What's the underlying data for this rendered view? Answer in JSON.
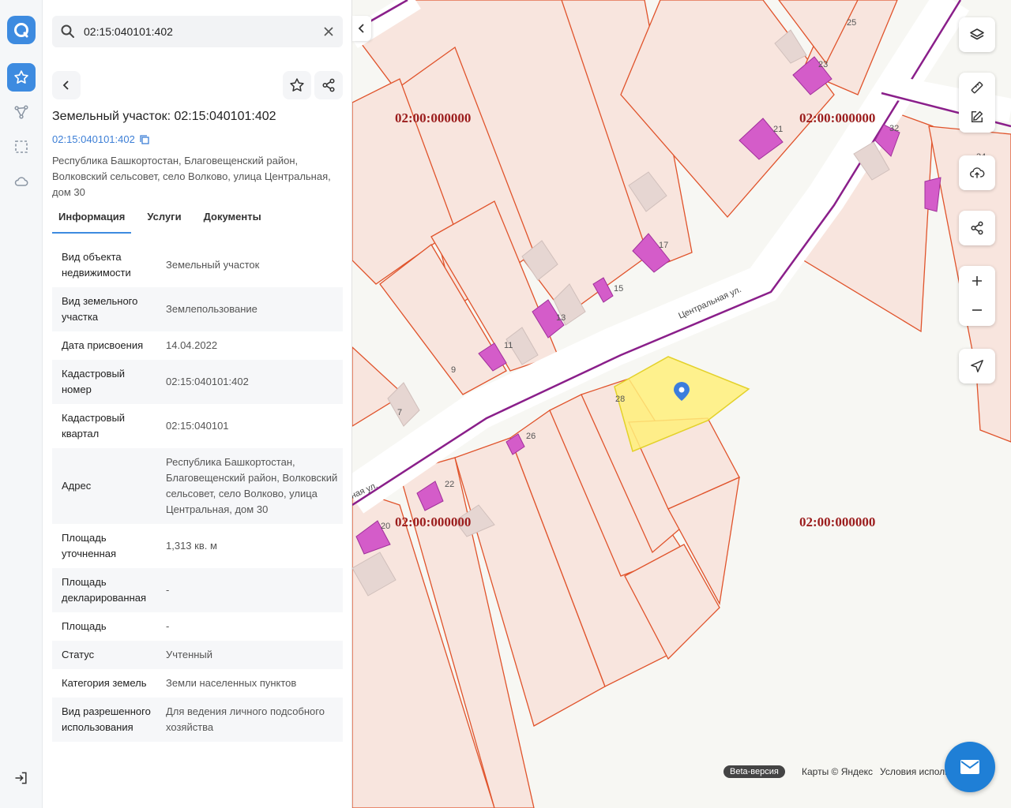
{
  "search": {
    "value": "02:15:040101:402"
  },
  "object": {
    "title": "Земельный участок: 02:15:040101:402",
    "cadastral_link": "02:15:040101:402",
    "address": "Республика Башкортостан, Благовещенский район, Волковский сельсовет, село Волково, улица Центральная, дом 30"
  },
  "tabs": [
    {
      "label": "Информация"
    },
    {
      "label": "Услуги"
    },
    {
      "label": "Документы"
    }
  ],
  "info": [
    {
      "key": "Вид объекта недвижимости",
      "value": "Земельный участок"
    },
    {
      "key": "Вид земельного участка",
      "value": "Землепользование"
    },
    {
      "key": "Дата присвоения",
      "value": "14.04.2022"
    },
    {
      "key": "Кадастровый номер",
      "value": "02:15:040101:402"
    },
    {
      "key": "Кадастровый квартал",
      "value": "02:15:040101"
    },
    {
      "key": "Адрес",
      "value": "Республика Башкортостан, Благовещенский район, Волковский сельсовет, село Волково, улица Центральная, дом 30"
    },
    {
      "key": "Площадь уточненная",
      "value": "1,313 кв. м"
    },
    {
      "key": "Площадь декларированная",
      "value": "-"
    },
    {
      "key": "Площадь",
      "value": "-"
    },
    {
      "key": "Статус",
      "value": "Учтенный"
    },
    {
      "key": "Категория земель",
      "value": "Земли населенных пунктов"
    },
    {
      "key": "Вид разрешенного использования",
      "value": "Для ведения личного подсобного хозяйства"
    }
  ],
  "map": {
    "quarter_label": "02:00:000000",
    "street": "Центральная ул.",
    "street_short": "ная ул.",
    "house_numbers": [
      "25",
      "23",
      "21",
      "32",
      "34",
      "17",
      "15",
      "13",
      "11",
      "9",
      "7",
      "28",
      "26",
      "22",
      "20"
    ],
    "beta": "Beta-версия",
    "credits": "Карты © Яндекс",
    "terms": "Условия использования"
  },
  "colors": {
    "accent": "#3d8be0",
    "parcel_fill": "#f8e5de",
    "parcel_stroke": "#e0532b",
    "building": "#d45cc9",
    "selected": "#fff07a",
    "road_line": "#8a1f8a",
    "quarter_label": "#9b1c1c"
  },
  "icons": {
    "logo": "app-logo-icon",
    "favorites": "star-icon",
    "route": "route-icon",
    "select": "selection-icon",
    "cloud": "cloud-icon",
    "logout": "logout-icon"
  }
}
